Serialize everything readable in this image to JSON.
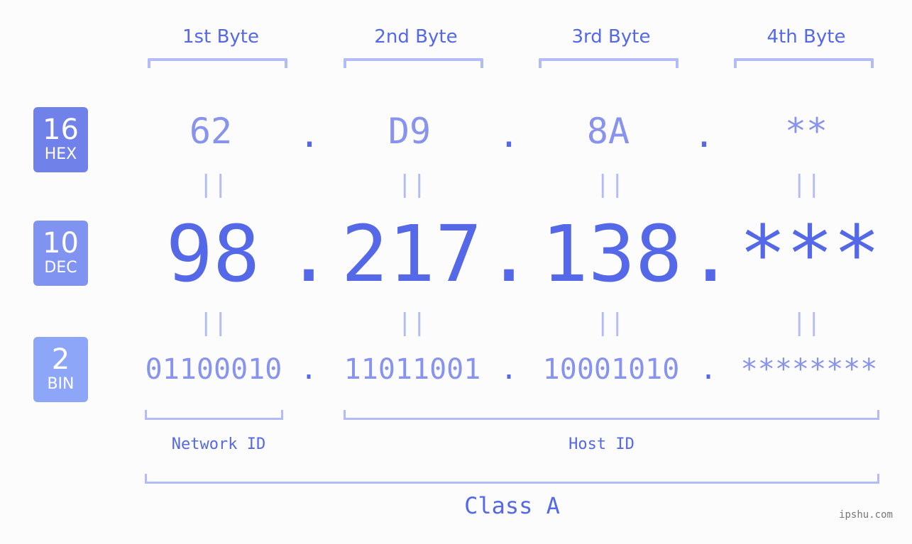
{
  "bytes": [
    {
      "header": "1st Byte",
      "hex": "62",
      "dec": "98",
      "bin": "01100010"
    },
    {
      "header": "2nd Byte",
      "hex": "D9",
      "dec": "217",
      "bin": "11011001"
    },
    {
      "header": "3rd Byte",
      "hex": "8A",
      "dec": "138",
      "bin": "10001010"
    },
    {
      "header": "4th Byte",
      "hex": "**",
      "dec": "***",
      "bin": "********"
    }
  ],
  "badges": {
    "hex": {
      "number": "16",
      "label": "HEX",
      "color": "#7181ea"
    },
    "dec": {
      "number": "10",
      "label": "DEC",
      "color": "#8193f0"
    },
    "bin": {
      "number": "2",
      "label": "BIN",
      "color": "#8ea6f7"
    }
  },
  "separator": ".",
  "equals": "||",
  "network_id_label": "Network ID",
  "host_id_label": "Host ID",
  "class_label": "Class A",
  "watermark": "ipshu.com",
  "colors": {
    "accent": "#5468e8",
    "secondary": "#8793ed",
    "bracket": "#b3bcf6",
    "background": "#fbfcfb"
  }
}
